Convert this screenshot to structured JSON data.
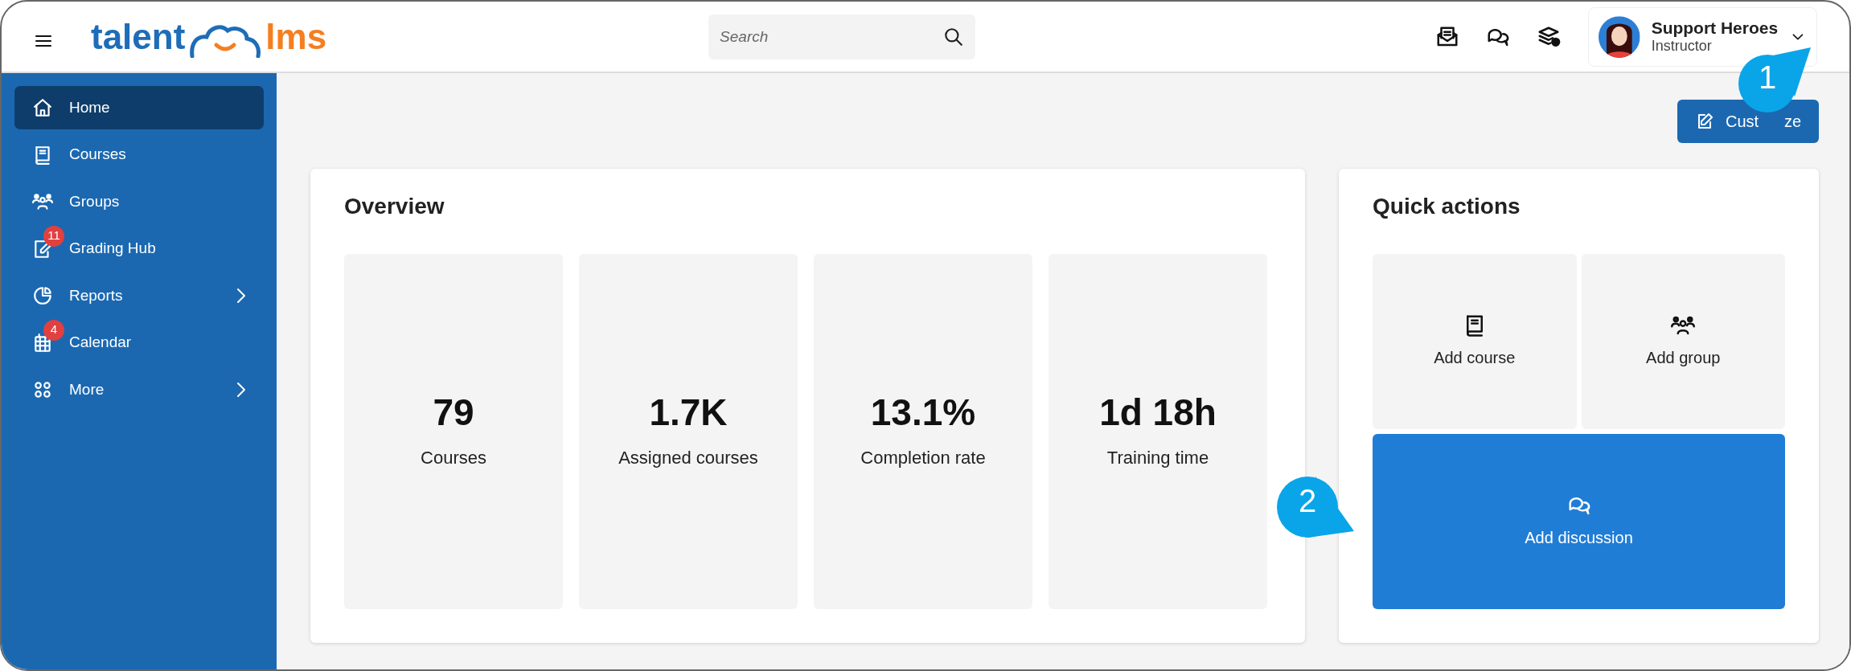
{
  "header": {
    "logo": {
      "left": "talent",
      "right": "lms"
    },
    "search": {
      "placeholder": "Search"
    },
    "user": {
      "name": "Support Heroes",
      "role": "Instructor"
    }
  },
  "sidebar": {
    "items": [
      {
        "label": "Home",
        "selected": true,
        "expandable": false
      },
      {
        "label": "Courses",
        "selected": false,
        "expandable": false
      },
      {
        "label": "Groups",
        "selected": false,
        "expandable": false
      },
      {
        "label": "Grading Hub",
        "selected": false,
        "expandable": false,
        "badge": "11"
      },
      {
        "label": "Reports",
        "selected": false,
        "expandable": true
      },
      {
        "label": "Calendar",
        "selected": false,
        "expandable": false,
        "badge": "4"
      },
      {
        "label": "More",
        "selected": false,
        "expandable": true
      }
    ]
  },
  "customize_button": {
    "visible_parts": [
      "Cust",
      "ze"
    ]
  },
  "overview": {
    "title": "Overview",
    "stats": [
      {
        "value": "79",
        "label": "Courses"
      },
      {
        "value": "1.7K",
        "label": "Assigned courses"
      },
      {
        "value": "13.1%",
        "label": "Completion rate"
      },
      {
        "value": "1d 18h",
        "label": "Training time"
      }
    ]
  },
  "quick_actions": {
    "title": "Quick actions",
    "actions": [
      {
        "label": "Add course",
        "highlighted": false
      },
      {
        "label": "Add group",
        "highlighted": false
      },
      {
        "label": "Add discussion",
        "highlighted": true
      }
    ]
  },
  "callouts": [
    {
      "label": "1"
    },
    {
      "label": "2"
    }
  ]
}
